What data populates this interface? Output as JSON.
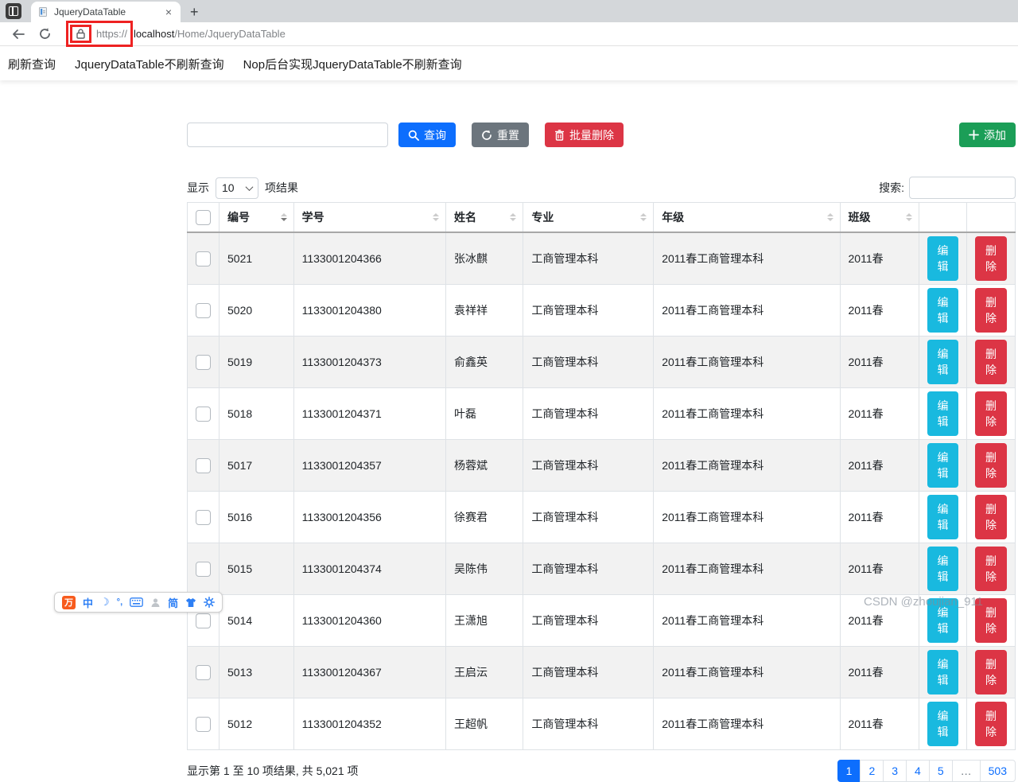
{
  "browser": {
    "tab_title": "JqueryDataTable",
    "tab_close": "×",
    "new_tab": "+",
    "url_scheme": "https://",
    "url_host": "localhost",
    "url_path": "/Home/JqueryDataTable"
  },
  "nav": {
    "links": [
      "刷新查询",
      "JqueryDataTable不刷新查询",
      "Nop后台实现JqueryDataTable不刷新查询"
    ]
  },
  "toolbar": {
    "keyword_value": "",
    "query_label": "查询",
    "reset_label": "重置",
    "batch_delete_label": "批量删除",
    "add_label": "添加"
  },
  "table_controls": {
    "show_label": "显示",
    "page_size": "10",
    "results_label": "项结果",
    "search_label": "搜索:",
    "search_value": ""
  },
  "table": {
    "headers": [
      "编号",
      "学号",
      "姓名",
      "专业",
      "年级",
      "班级"
    ],
    "edit_label": "编辑",
    "delete_label": "删除",
    "rows": [
      {
        "id": "5021",
        "student_no": "1133001204366",
        "name": "张冰麒",
        "major": "工商管理本科",
        "grade": "2011春工商管理本科",
        "class_name": "2011春"
      },
      {
        "id": "5020",
        "student_no": "1133001204380",
        "name": "袁祥祥",
        "major": "工商管理本科",
        "grade": "2011春工商管理本科",
        "class_name": "2011春"
      },
      {
        "id": "5019",
        "student_no": "1133001204373",
        "name": "俞鑫英",
        "major": "工商管理本科",
        "grade": "2011春工商管理本科",
        "class_name": "2011春"
      },
      {
        "id": "5018",
        "student_no": "1133001204371",
        "name": "叶磊",
        "major": "工商管理本科",
        "grade": "2011春工商管理本科",
        "class_name": "2011春"
      },
      {
        "id": "5017",
        "student_no": "1133001204357",
        "name": "杨蓉斌",
        "major": "工商管理本科",
        "grade": "2011春工商管理本科",
        "class_name": "2011春"
      },
      {
        "id": "5016",
        "student_no": "1133001204356",
        "name": "徐赛君",
        "major": "工商管理本科",
        "grade": "2011春工商管理本科",
        "class_name": "2011春"
      },
      {
        "id": "5015",
        "student_no": "1133001204374",
        "name": "吴陈伟",
        "major": "工商管理本科",
        "grade": "2011春工商管理本科",
        "class_name": "2011春"
      },
      {
        "id": "5014",
        "student_no": "1133001204360",
        "name": "王潇旭",
        "major": "工商管理本科",
        "grade": "2011春工商管理本科",
        "class_name": "2011春"
      },
      {
        "id": "5013",
        "student_no": "1133001204367",
        "name": "王启沄",
        "major": "工商管理本科",
        "grade": "2011春工商管理本科",
        "class_name": "2011春"
      },
      {
        "id": "5012",
        "student_no": "1133001204352",
        "name": "王超帆",
        "major": "工商管理本科",
        "grade": "2011春工商管理本科",
        "class_name": "2011春"
      }
    ]
  },
  "footer": {
    "info": "显示第 1 至 10 项结果, 共 5,021 项",
    "pages": [
      "1",
      "2",
      "3",
      "4",
      "5",
      "…",
      "503"
    ],
    "active_index": 0
  },
  "ime": {
    "logo": "万",
    "lang": "中",
    "moon": "☽",
    "punct": "°,",
    "simplified": "简"
  },
  "watermark": "CSDN @zhoujian_911",
  "colors": {
    "primary": "#0d6efd",
    "secondary": "#6c757d",
    "danger": "#dc3545",
    "success": "#1b9e57",
    "info_cyan": "#19b9df",
    "stripe": "#f2f2f2",
    "table_border": "#dee2e6",
    "annotation_red": "#ee2222"
  }
}
